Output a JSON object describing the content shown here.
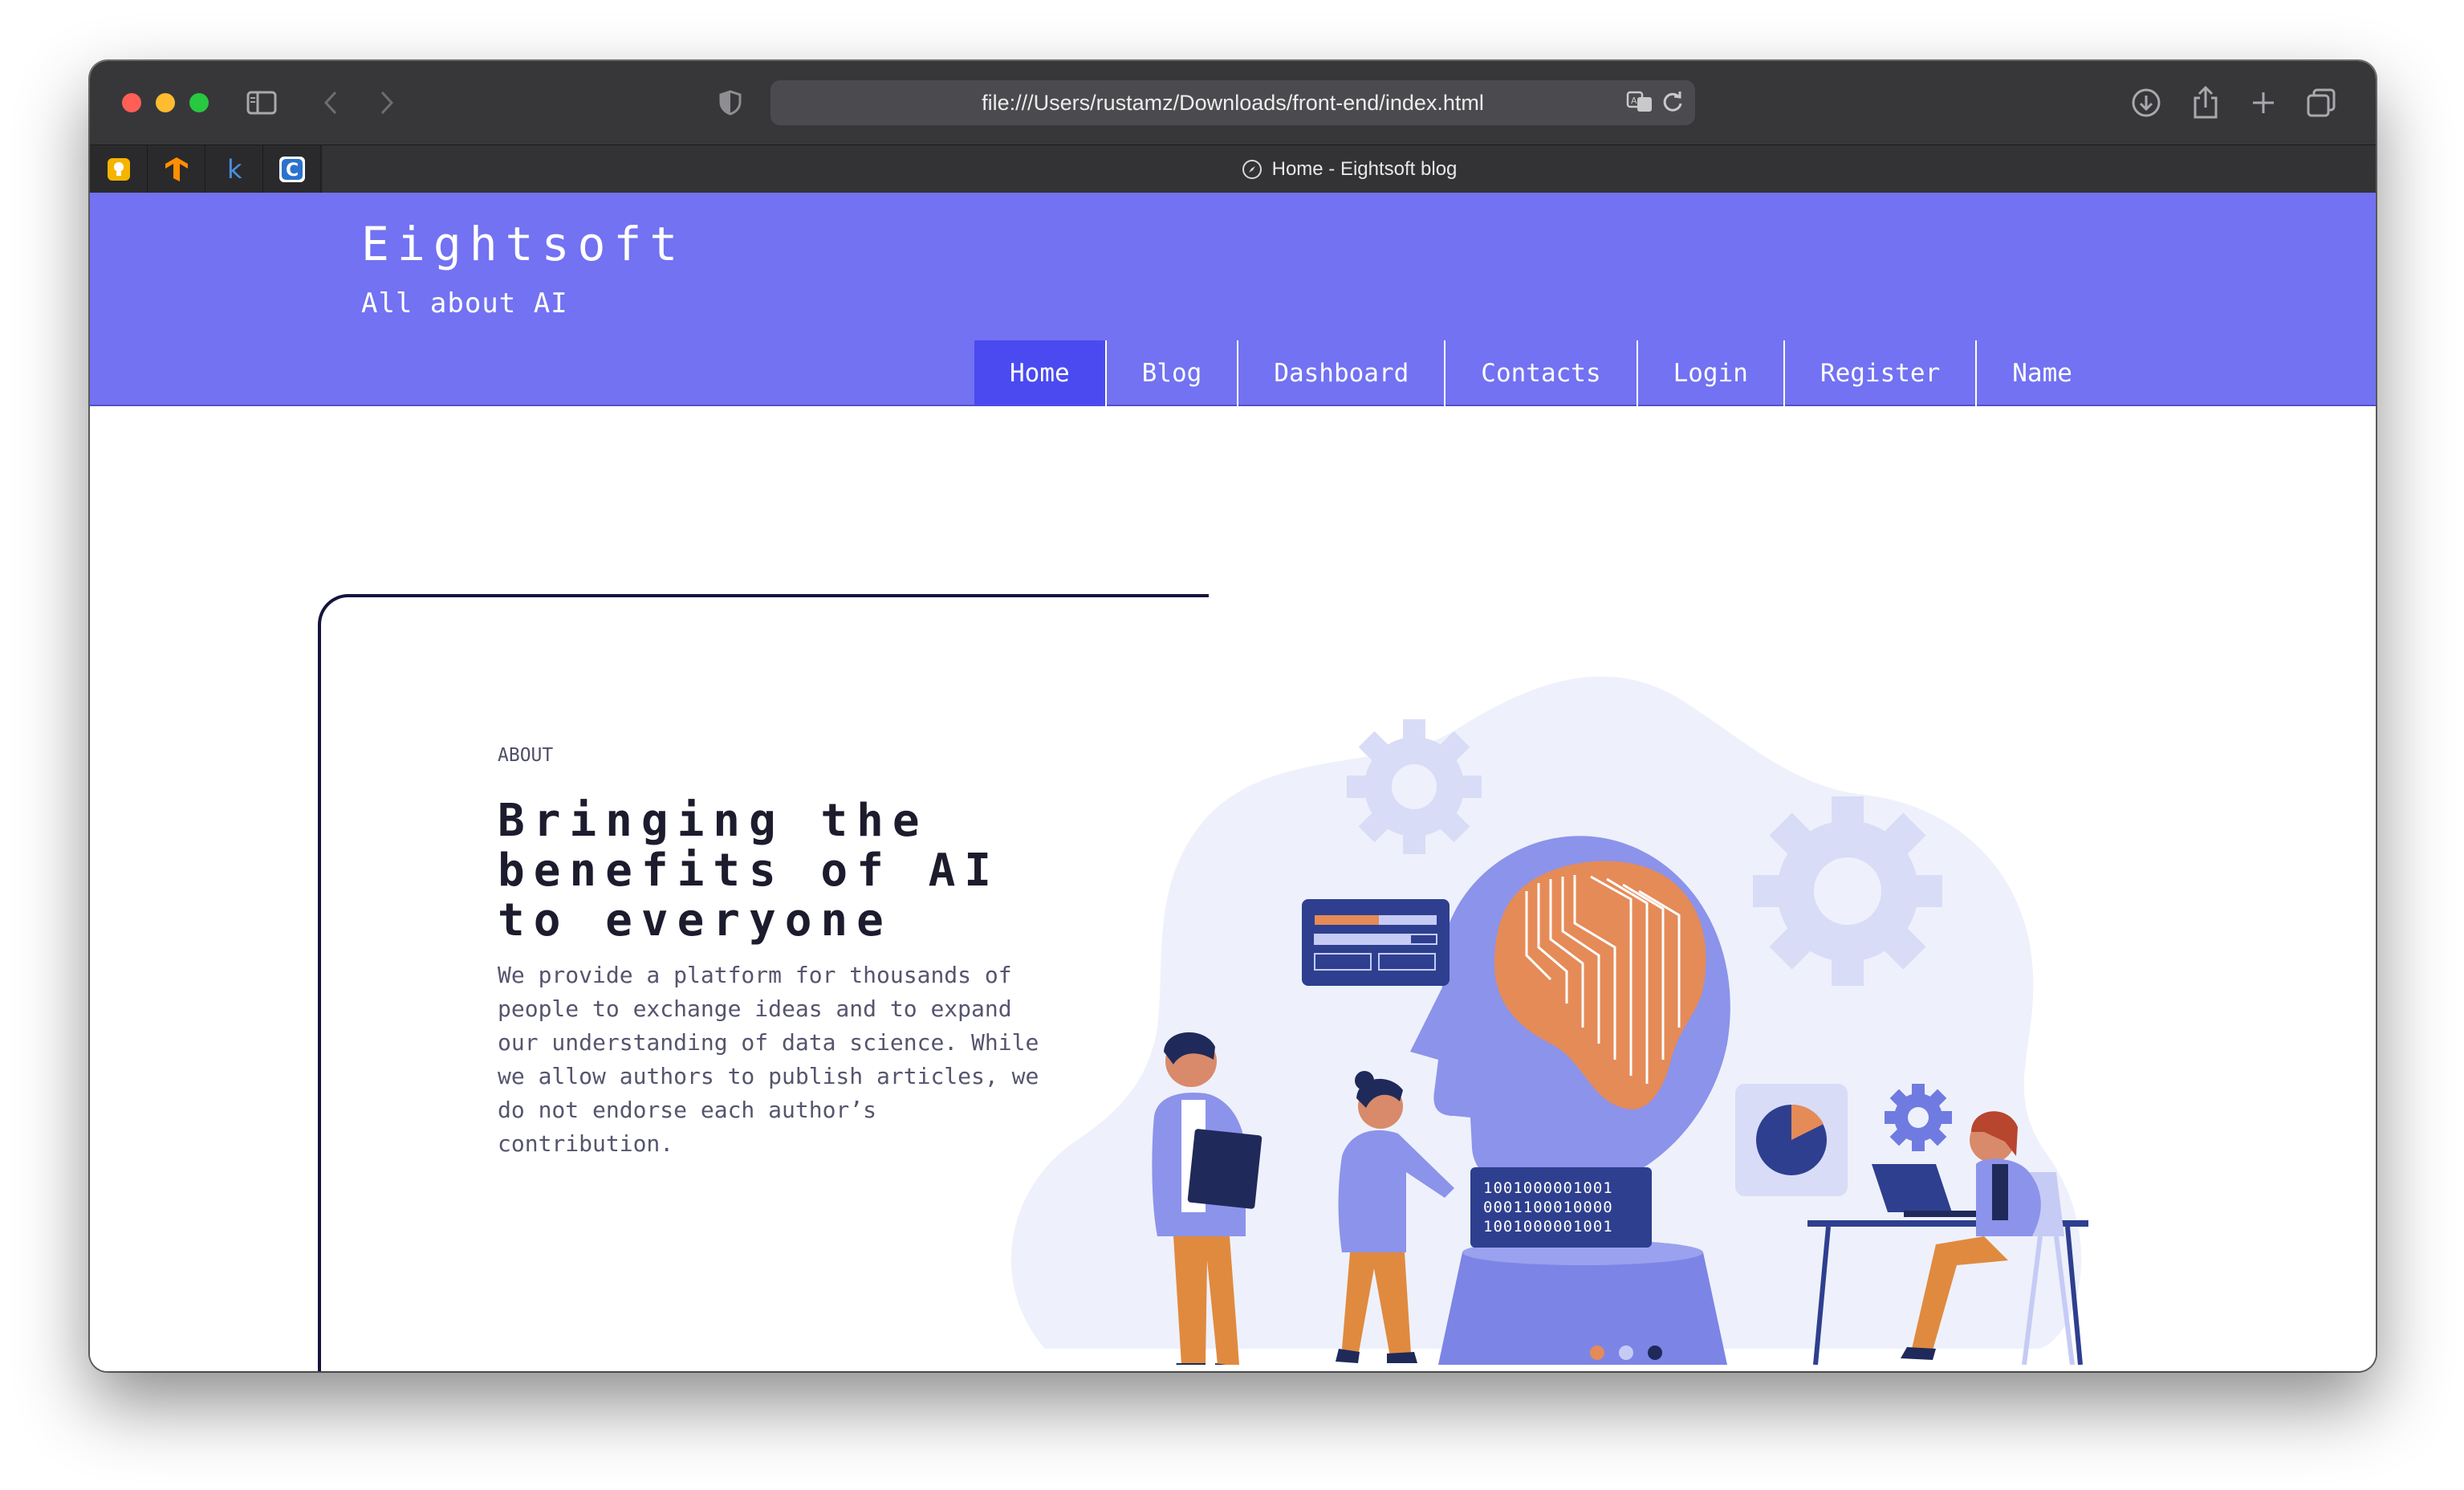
{
  "browser": {
    "url": "file:///Users/rustamz/Downloads/front-end/index.html",
    "tab_title": "Home - Eightsoft blog",
    "pinned_tabs": [
      "keep-icon",
      "tensorflow-icon",
      "kotlin-icon",
      "coursera-icon"
    ]
  },
  "site": {
    "brand": "Eightsoft",
    "tagline": "All about AI",
    "nav": [
      "Home",
      "Blog",
      "Dashboard",
      "Contacts",
      "Login",
      "Register",
      "Name"
    ],
    "active_nav": "Home",
    "accent_color": "#7272f2",
    "active_nav_color": "#4a4af0"
  },
  "hero": {
    "eyebrow": "ABOUT",
    "headline": "Bringing the benefits of AI to everyone",
    "body": "We provide a platform for thousands of people to exchange ideas and to expand our understanding of data science. While we allow authors to publish articles, we do not endorse each author’s contribution.",
    "illustration": "ai-head-team-illustration",
    "binary_lines": [
      "1001000001001",
      "0001100010000",
      "1001000001001"
    ]
  }
}
